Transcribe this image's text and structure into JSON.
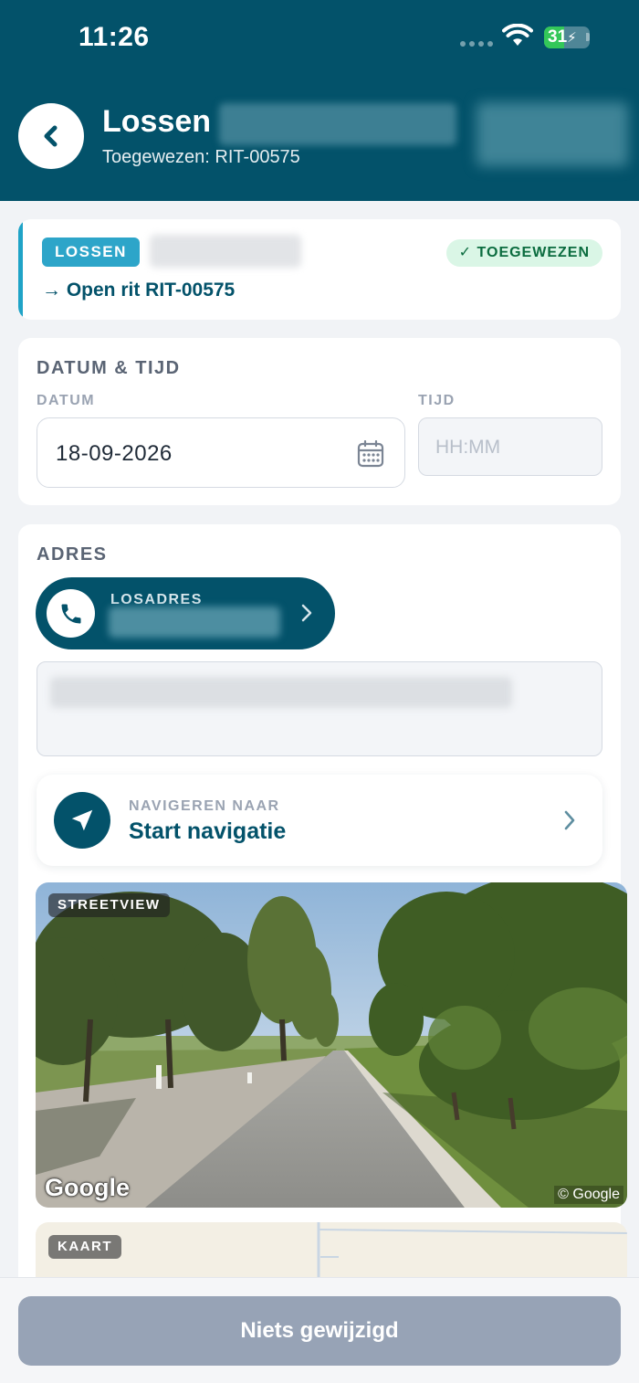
{
  "status_bar": {
    "time": "11:26",
    "battery": "31"
  },
  "header": {
    "title": "Lossen",
    "subtitle": "Toegewezen: RIT-00575"
  },
  "stop_card": {
    "type_badge": "LOSSEN",
    "status_badge": "✓ TOEGEWEZEN",
    "open_ride_link": "→ Open rit RIT-00575"
  },
  "datetime": {
    "section_title": "DATUM & TIJD",
    "date_label": "DATUM",
    "date_value": "18-09-2026",
    "time_label": "TIJD",
    "time_placeholder": "HH:MM"
  },
  "address": {
    "section_title": "ADRES",
    "contact_label": "LOSADRES",
    "navigate_caption": "NAVIGEREN NAAR",
    "navigate_title": "Start navigatie"
  },
  "streetview": {
    "tag": "STREETVIEW",
    "logo_text": "Google",
    "copyright": "© Google"
  },
  "map": {
    "tag": "KAART"
  },
  "footer": {
    "save_label": "Niets gewijzigd"
  },
  "colors": {
    "primary": "#03526a",
    "accent": "#2da5c9",
    "success_bg": "#daf6e6",
    "success_text": "#0b6c3f",
    "disabled_button": "#97a3b6"
  }
}
